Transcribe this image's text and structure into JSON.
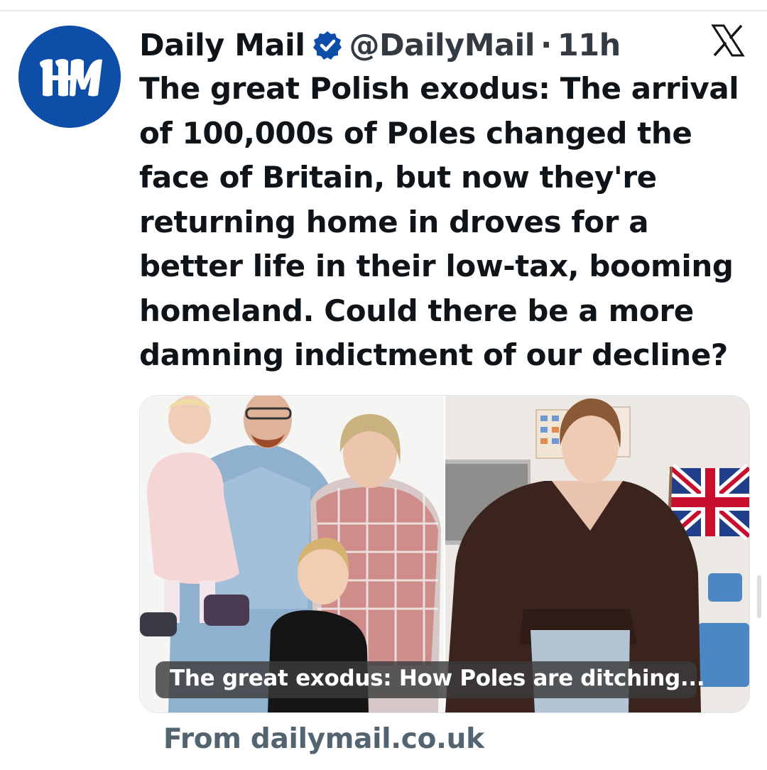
{
  "account": {
    "display_name": "Daily Mail",
    "handle": "@DailyMail",
    "separator": "·",
    "time": "11h",
    "avatar_icon": "daily-mail-logo-icon",
    "avatar_color": "#0f4ea8",
    "verified_color": "#0f4ea8"
  },
  "tweet": {
    "lines": [
      "The great Polish exodus: The arrival",
      "of 100,000s of Poles changed the",
      "face of Britain, but now they're",
      "returning home in droves for a",
      "better life in their low-tax, booming",
      "homeland. Could there be a more",
      "damning indictment of our decline?"
    ]
  },
  "link_card": {
    "caption": "The great exodus: How Poles are ditching...",
    "source": "From dailymail.co.uk"
  },
  "icons": {
    "platform": "x-logo-icon",
    "verified": "verified-badge-icon"
  }
}
